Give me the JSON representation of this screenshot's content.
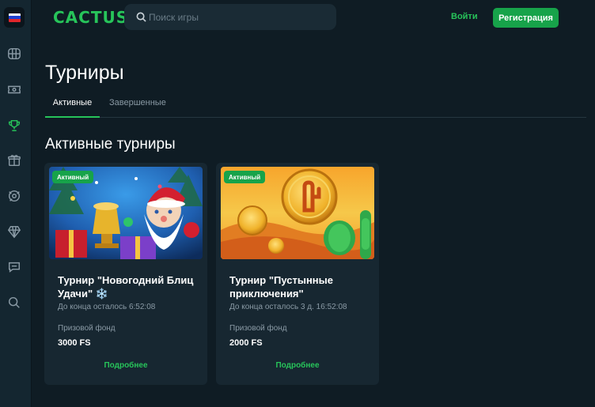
{
  "brand": {
    "logo": "CACTUS",
    "accent": "#27c45a"
  },
  "search": {
    "placeholder": "Поиск игры"
  },
  "header": {
    "login_label": "Войти",
    "register_label": "Регистрация"
  },
  "sidebar": {
    "language": "ru",
    "icons": [
      "slots-icon",
      "live-casino-icon",
      "tournaments-icon",
      "gifts-icon",
      "roulette-icon",
      "vip-diamond-icon",
      "support-chat-icon",
      "search-icon"
    ],
    "active": "tournaments-icon"
  },
  "page": {
    "title": "Турниры",
    "section_title": "Активные турниры"
  },
  "tabs": [
    {
      "label": "Активные",
      "active": true
    },
    {
      "label": "Завершенные",
      "active": false
    }
  ],
  "tournaments": [
    {
      "badge": "Активный",
      "title": "Турнир \"Новогодний Блиц Удачи\" ❄️",
      "countdown": "До конца осталось 6:52:08",
      "prize_label": "Призовой фонд",
      "prize_value": "3000 FS",
      "more_label": "Подробнее"
    },
    {
      "badge": "Активный",
      "title": "Турнир \"Пустынные приключения\"",
      "countdown": "До конца осталось 3 д. 16:52:08",
      "prize_label": "Призовой фонд",
      "prize_value": "2000 FS",
      "more_label": "Подробнее"
    }
  ]
}
